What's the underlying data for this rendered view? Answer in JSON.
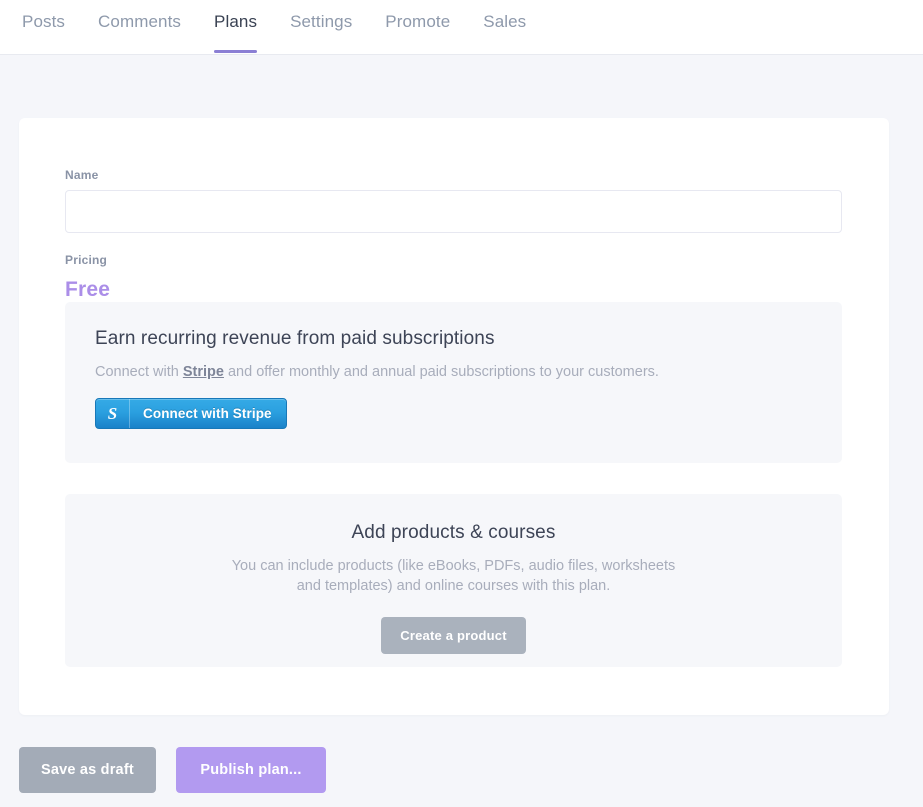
{
  "tabs": [
    {
      "label": "Posts",
      "active": false
    },
    {
      "label": "Comments",
      "active": false
    },
    {
      "label": "Plans",
      "active": true
    },
    {
      "label": "Settings",
      "active": false
    },
    {
      "label": "Promote",
      "active": false
    },
    {
      "label": "Sales",
      "active": false
    }
  ],
  "form": {
    "name_label": "Name",
    "name_value": "",
    "name_placeholder": "",
    "pricing_label": "Pricing",
    "pricing_value": "Free"
  },
  "stripe_panel": {
    "title": "Earn recurring revenue from paid subscriptions",
    "desc_before": "Connect with ",
    "link_text": "Stripe",
    "desc_after": " and offer monthly and annual paid subscriptions to your customers.",
    "button_logo": "S",
    "button_label": "Connect with Stripe"
  },
  "products_panel": {
    "title": "Add products & courses",
    "description": "You can include products (like eBooks, PDFs, audio files, worksheets and templates) and online courses with this plan.",
    "button_label": "Create a product"
  },
  "footer": {
    "save_draft_label": "Save as draft",
    "publish_label": "Publish plan..."
  },
  "colors": {
    "page_background": "#f5f6fa",
    "accent_purple": "#b29af0",
    "free_purple": "#ab8ee8",
    "tab_underline": "#8b7fd4",
    "panel_background": "#f6f7fa",
    "stripe_blue": "#2ba0e0",
    "muted_gray": "#a8adbb",
    "button_gray": "#a3abb7"
  }
}
